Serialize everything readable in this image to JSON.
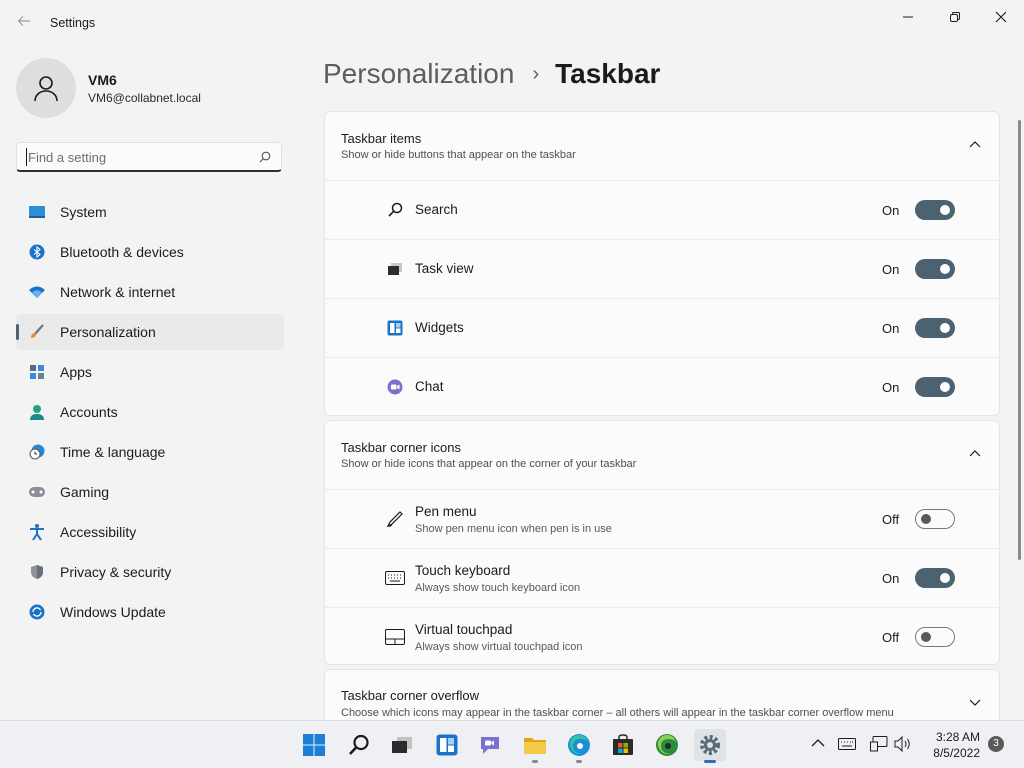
{
  "window": {
    "title": "Settings"
  },
  "profile": {
    "name": "VM6",
    "email": "VM6@collabnet.local"
  },
  "search": {
    "placeholder": "Find a setting",
    "value": ""
  },
  "nav": {
    "items": [
      {
        "label": "System",
        "icon": "monitor-icon"
      },
      {
        "label": "Bluetooth & devices",
        "icon": "bluetooth-icon"
      },
      {
        "label": "Network & internet",
        "icon": "wifi-icon"
      },
      {
        "label": "Personalization",
        "icon": "brush-icon",
        "selected": true
      },
      {
        "label": "Apps",
        "icon": "apps-icon"
      },
      {
        "label": "Accounts",
        "icon": "account-icon"
      },
      {
        "label": "Time & language",
        "icon": "clock-globe-icon"
      },
      {
        "label": "Gaming",
        "icon": "gamepad-icon"
      },
      {
        "label": "Accessibility",
        "icon": "accessibility-icon"
      },
      {
        "label": "Privacy & security",
        "icon": "shield-icon"
      },
      {
        "label": "Windows Update",
        "icon": "update-icon"
      }
    ]
  },
  "breadcrumb": {
    "parent": "Personalization",
    "separator": "›",
    "current": "Taskbar"
  },
  "sections": {
    "items": {
      "title": "Taskbar items",
      "subtitle": "Show or hide buttons that appear on the taskbar",
      "rows": [
        {
          "label": "Search",
          "state": "On",
          "on": true,
          "icon": "search-icon"
        },
        {
          "label": "Task view",
          "state": "On",
          "on": true,
          "icon": "task-view-icon"
        },
        {
          "label": "Widgets",
          "state": "On",
          "on": true,
          "icon": "widgets-icon"
        },
        {
          "label": "Chat",
          "state": "On",
          "on": true,
          "icon": "chat-icon"
        }
      ]
    },
    "corner": {
      "title": "Taskbar corner icons",
      "subtitle": "Show or hide icons that appear on the corner of your taskbar",
      "rows": [
        {
          "label": "Pen menu",
          "desc": "Show pen menu icon when pen is in use",
          "state": "Off",
          "on": false,
          "icon": "pen-icon"
        },
        {
          "label": "Touch keyboard",
          "desc": "Always show touch keyboard icon",
          "state": "On",
          "on": true,
          "icon": "keyboard-icon"
        },
        {
          "label": "Virtual touchpad",
          "desc": "Always show virtual touchpad icon",
          "state": "Off",
          "on": false,
          "icon": "touchpad-icon"
        }
      ]
    },
    "overflow": {
      "title": "Taskbar corner overflow",
      "subtitle": "Choose which icons may appear in the taskbar corner – all others will appear in the taskbar corner overflow menu"
    }
  },
  "colors": {
    "accent": "#4d6270",
    "background": "#f3f3f3",
    "card": "#fbfbfb"
  },
  "taskbar": {
    "apps": [
      "start-icon",
      "search-icon",
      "task-view-icon",
      "widgets-icon",
      "teams-chat-icon",
      "file-explorer-icon",
      "edge-icon",
      "store-icon",
      "edge-dev-icon",
      "settings-icon"
    ],
    "clock": {
      "time": "3:28 AM",
      "date": "8/5/2022"
    },
    "notifications": "3"
  }
}
